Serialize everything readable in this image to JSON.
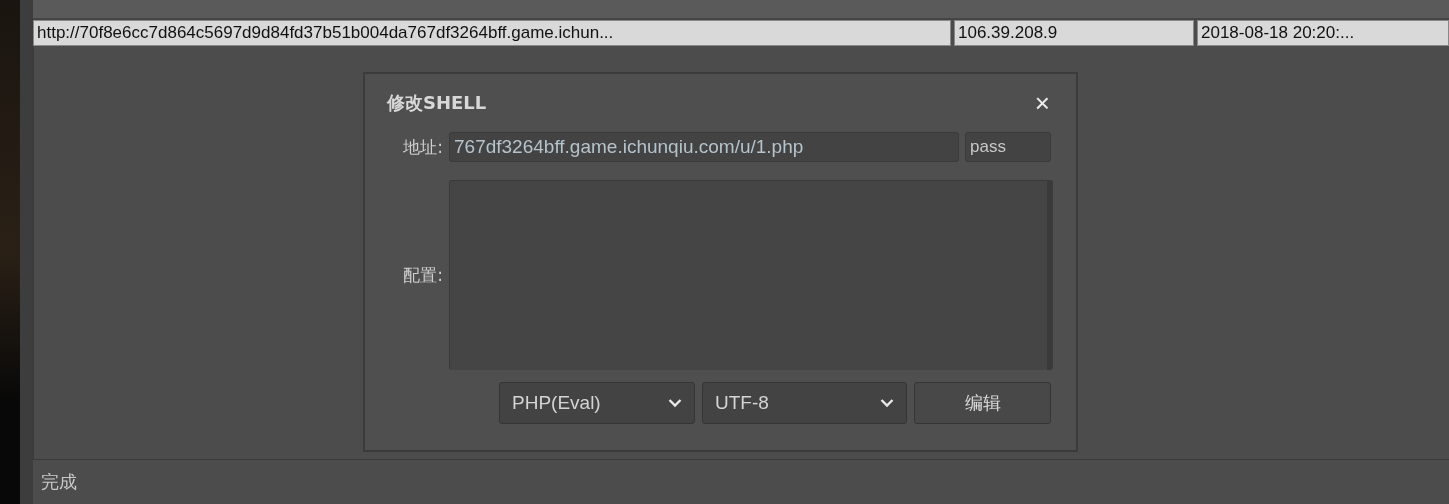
{
  "table": {
    "rows": [
      {
        "selected": true,
        "cells": [
          "http://70f8e6cc7d864c5697d9d84fd37b51b004da767df3264bff.game.ichun...",
          "106.39.208.9",
          "2018-08-18 20:20:..."
        ]
      }
    ]
  },
  "dialog": {
    "title": "修改SHELL",
    "close": "×",
    "address_label": "地址:",
    "address_value": "767df3264bff.game.ichunqiu.com/u/1.php",
    "password_value": "pass",
    "config_label": "配置:",
    "selects": [
      {
        "value": "PHP(Eval)"
      },
      {
        "value": "UTF-8"
      }
    ],
    "button": "编辑"
  },
  "status_bar": "完成"
}
